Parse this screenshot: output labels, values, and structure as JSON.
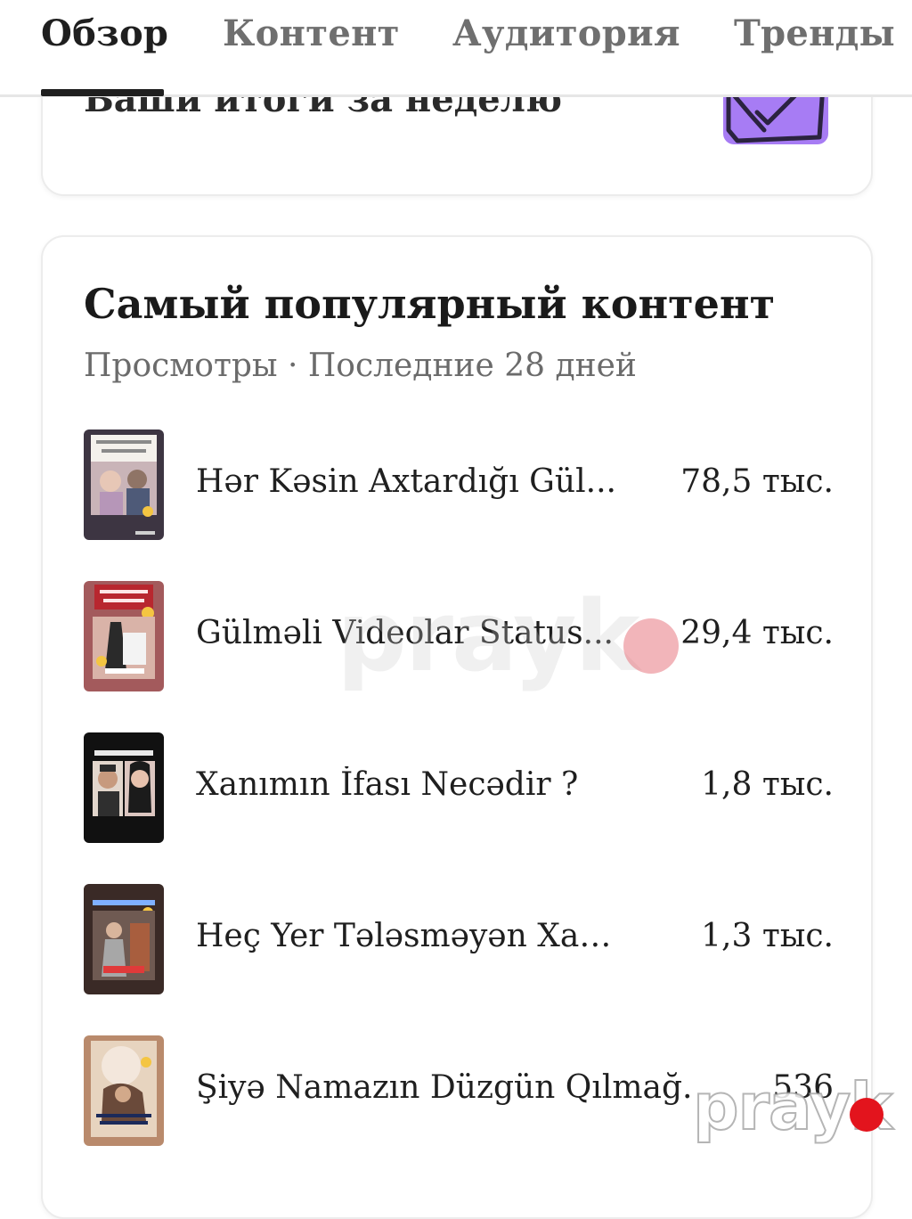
{
  "tabs": [
    {
      "label": "Обзор",
      "active": true
    },
    {
      "label": "Контент",
      "active": false
    },
    {
      "label": "Аудитория",
      "active": false
    },
    {
      "label": "Тренды",
      "active": false
    }
  ],
  "weekly_card": {
    "title": "Ваши итоги за неделю",
    "icon": "envelope-check-icon",
    "icon_color": "#a77cf4"
  },
  "popular": {
    "title": "Самый популярный контент",
    "subtitle": "Просмотры · Последние 28 дней",
    "items": [
      {
        "title": "Hər Kəsin Axtardığı Gül...",
        "views": "78,5 тыс."
      },
      {
        "title": "Gülməli Videolar Status...",
        "views": "29,4 тыс."
      },
      {
        "title": "Xanımın İfası Necədir ?",
        "views": "1,8 тыс."
      },
      {
        "title": "Heç Yer Tələsməyən Xanı...",
        "views": "1,3 тыс."
      },
      {
        "title": "Şiyə Namazın Düzgün Qılmağ...",
        "views": "536"
      }
    ]
  },
  "watermark": {
    "text": "prayk",
    "accent": "#e3141d"
  }
}
